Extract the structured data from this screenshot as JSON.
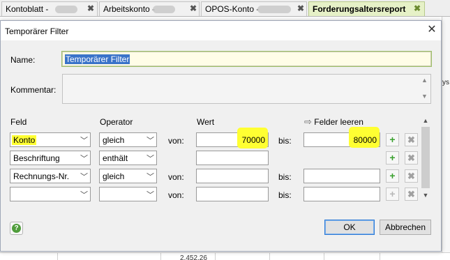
{
  "tabs": [
    {
      "label": "Kontoblatt - ",
      "active": false
    },
    {
      "label": "Arbeitskonto - ",
      "active": false
    },
    {
      "label": "OPOS-Konto - ",
      "active": false
    },
    {
      "label": "Forderungsaltersreport",
      "active": true
    }
  ],
  "tab_close_glyph": "✖",
  "background": {
    "side_fragment": "ys",
    "bottom_value": "2.452,26"
  },
  "dialog": {
    "title": "Temporärer Filter",
    "close_glyph": "✕",
    "name_label": "Name:",
    "name_value": "Temporärer Filter",
    "comment_label": "Kommentar:",
    "comment_value": "",
    "headers": {
      "field": "Feld",
      "operator": "Operator",
      "value": "Wert",
      "clear": "Felder leeren",
      "clear_icon": "arrow-right-icon"
    },
    "rows": [
      {
        "field": "Konto",
        "operator": "gleich",
        "from_label": "von:",
        "from": "70000",
        "to_label": "bis:",
        "to": "80000",
        "add": "+",
        "remove": "✖"
      },
      {
        "field": "Beschriftung",
        "operator": "enthält",
        "from_label": "",
        "from": "",
        "to_label": "",
        "to": "",
        "add": "+",
        "remove": "✖"
      },
      {
        "field": "Rechnungs-Nr.",
        "operator": "gleich",
        "from_label": "von:",
        "from": "",
        "to_label": "bis:",
        "to": "",
        "add": "+",
        "remove": "✖"
      },
      {
        "field": "",
        "operator": "",
        "from_label": "von:",
        "from": "",
        "to_label": "bis:",
        "to": "",
        "add": "+",
        "remove": "✖"
      }
    ],
    "help_glyph": "?",
    "ok_label": "OK",
    "cancel_label": "Abbrechen"
  },
  "colors": {
    "highlight": "#ffff32",
    "active_tab": "#e6f1c7",
    "selection": "#3a73c9",
    "add_green": "#39a02d"
  }
}
